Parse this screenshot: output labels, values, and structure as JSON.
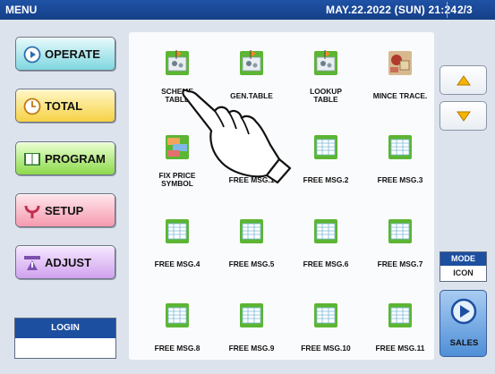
{
  "header": {
    "title": "MENU",
    "datetime": "MAY.22.2022 (SUN)  21:24",
    "page": "2/3"
  },
  "menu": [
    {
      "label": "OPERATE",
      "icon": "play-icon"
    },
    {
      "label": "TOTAL",
      "icon": "clock-icon"
    },
    {
      "label": "PROGRAM",
      "icon": "book-icon"
    },
    {
      "label": "SETUP",
      "icon": "wrench-icon"
    },
    {
      "label": "ADJUST",
      "icon": "ruler-icon"
    }
  ],
  "login": {
    "label": "LOGIN",
    "value": ""
  },
  "tiles": [
    {
      "label": "SCHEME\nTABLE",
      "icon": "scheme-table-icon"
    },
    {
      "label": "GEN.TABLE",
      "icon": "gen-table-icon"
    },
    {
      "label": "LOOKUP\nTABLE",
      "icon": "lookup-table-icon"
    },
    {
      "label": "MINCE TRACE.",
      "icon": "mince-trace-icon"
    },
    {
      "label": "FIX PRICE\nSYMBOL",
      "icon": "fix-price-symbol-icon"
    },
    {
      "label": "FREE MSG.1",
      "icon": "free-msg-icon"
    },
    {
      "label": "FREE MSG.2",
      "icon": "free-msg-icon"
    },
    {
      "label": "FREE MSG.3",
      "icon": "free-msg-icon"
    },
    {
      "label": "FREE MSG.4",
      "icon": "free-msg-icon"
    },
    {
      "label": "FREE MSG.5",
      "icon": "free-msg-icon"
    },
    {
      "label": "FREE MSG.6",
      "icon": "free-msg-icon"
    },
    {
      "label": "FREE MSG.7",
      "icon": "free-msg-icon"
    },
    {
      "label": "FREE MSG.8",
      "icon": "free-msg-icon"
    },
    {
      "label": "FREE MSG.9",
      "icon": "free-msg-icon"
    },
    {
      "label": "FREE MSG.10",
      "icon": "free-msg-icon"
    },
    {
      "label": "FREE MSG.11",
      "icon": "free-msg-icon"
    }
  ],
  "nav": {
    "up_icon": "triangle-up-icon",
    "down_icon": "triangle-down-icon"
  },
  "mode": {
    "label": "MODE",
    "value": "ICON"
  },
  "sales": {
    "label": "SALES",
    "icon": "play-circle-icon"
  },
  "colors": {
    "header": "#1d4fa0",
    "accent_orange": "#f08a24",
    "icon_green": "#5cb533"
  }
}
